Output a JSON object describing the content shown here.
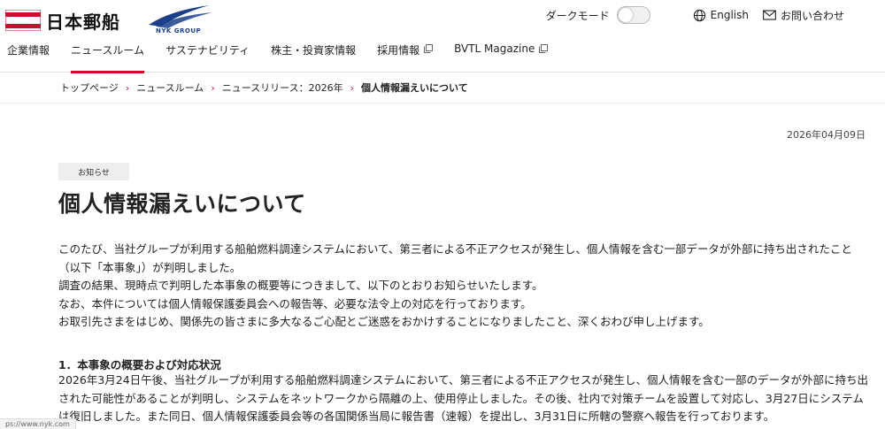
{
  "header": {
    "brand_name": "日本郵船",
    "group_label": "NYK GROUP",
    "dark_mode_label": "ダークモード",
    "english_label": "English",
    "contact_label": "お問い合わせ"
  },
  "nav": {
    "items": [
      {
        "label": "企業情報"
      },
      {
        "label": "ニュースルーム"
      },
      {
        "label": "サステナビリティ"
      },
      {
        "label": "株主・投資家情報"
      },
      {
        "label": "採用情報"
      },
      {
        "label": "BVTL Magazine"
      }
    ]
  },
  "breadcrumb": {
    "items": [
      "トップページ",
      "ニュースルーム",
      "ニュースリリース：2026年",
      "個人情報漏えいについて"
    ]
  },
  "article": {
    "date": "2026年04月09日",
    "tag": "お知らせ",
    "title": "個人情報漏えいについて",
    "intro": [
      "このたび、当社グループが利用する船舶燃料調達システムにおいて、第三者による不正アクセスが発生し、個人情報を含む一部データが外部に持ち出されたこと（以下「本事象」）が判明しました。",
      "調査の結果、現時点で判明した本事象の概要等につきまして、以下のとおりお知らせいたします。",
      "なお、本件については個人情報保護委員会への報告等、必要な法令上の対応を行っております。",
      "お取引先さまをはじめ、関係先の皆さまに多大なるご心配とご迷惑をおかけすることになりましたこと、深くおわび申し上げます。"
    ],
    "section1_heading": "1．本事象の概要および対応状況",
    "section1_body": "2026年3月24日午後、当社グループが利用する船舶燃料調達システムにおいて、第三者による不正アクセスが発生し、個人情報を含む一部のデータが外部に持ち出された可能性があることが判明し、システムをネットワークから隔離の上、使用停止しました。その後、社内で対策チームを設置して対応し、3月27日にシステムは復旧しました。また同日、個人情報保護委員会等の各国関係当局に報告書（速報）を提出し、3月31日に所轄の警察へ報告を行っております。"
  },
  "status_bar": {
    "url": "ps://www.nyk.com"
  },
  "colors": {
    "accent": "#c8102e",
    "nyk_blue": "#1b3f8a"
  }
}
